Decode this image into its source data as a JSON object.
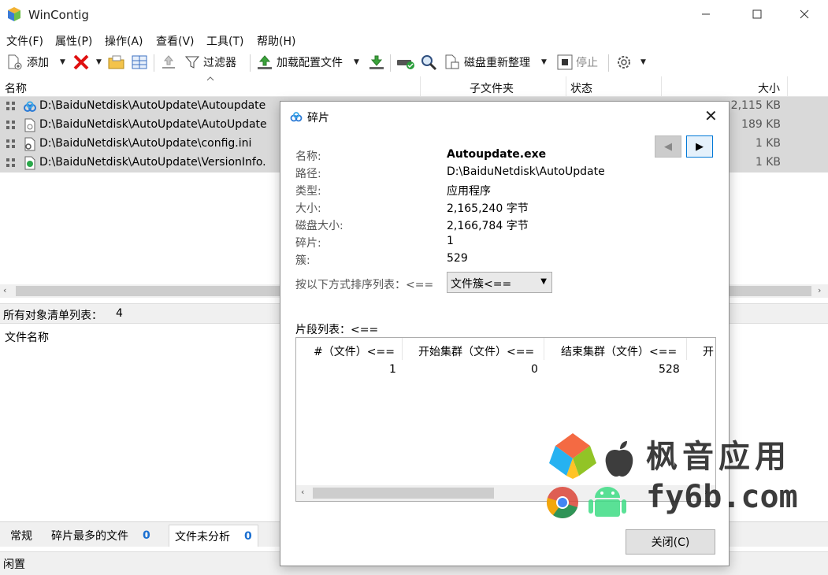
{
  "app": {
    "title": "WinContig"
  },
  "menu": [
    "文件(F)",
    "属性(P)",
    "操作(A)",
    "查看(V)",
    "工具(T)",
    "帮助(H)"
  ],
  "toolbar": {
    "add": "添加",
    "filter": "过滤器",
    "load_profile": "加载配置文件",
    "defrag": "磁盘重新整理",
    "stop": "停止"
  },
  "list": {
    "columns": {
      "name": "名称",
      "subfolder": "子文件夹",
      "status": "状态",
      "size": "大小"
    },
    "rows": [
      {
        "name": "D:\\BaiduNetdisk\\AutoUpdate\\Autoupdate",
        "size": "2,115 KB"
      },
      {
        "name": "D:\\BaiduNetdisk\\AutoUpdate\\AutoUpdate",
        "size": "189 KB"
      },
      {
        "name": "D:\\BaiduNetdisk\\AutoUpdate\\config.ini",
        "size": "1 KB"
      },
      {
        "name": "D:\\BaiduNetdisk\\AutoUpdate\\VersionInfo.",
        "size": "1 KB"
      }
    ]
  },
  "object_count": {
    "label": "所有对象清单列表：",
    "value": "4"
  },
  "file_name_label": "文件名称",
  "tabs": [
    {
      "label": "常规",
      "count": ""
    },
    {
      "label": "碎片最多的文件",
      "count": "0"
    },
    {
      "label": "文件未分析",
      "count": "0"
    }
  ],
  "status": "闲置",
  "dialog": {
    "title": "碎片",
    "fields": [
      {
        "label": "名称:",
        "value": "Autoupdate.exe"
      },
      {
        "label": "路径:",
        "value": "D:\\BaiduNetdisk\\AutoUpdate"
      },
      {
        "label": "类型:",
        "value": "应用程序"
      },
      {
        "label": "大小:",
        "value": "2,165,240 字节"
      },
      {
        "label": "磁盘大小:",
        "value": "2,166,784 字节"
      },
      {
        "label": "碎片:",
        "value": "1"
      },
      {
        "label": "簇:",
        "value": "529"
      }
    ],
    "sort_label": "按以下方式排序列表：<==",
    "sort_value": "文件簇<==",
    "fragments_label": "片段列表：<==",
    "fragment_columns": [
      "#（文件）<==",
      "开始集群（文件）<==",
      "结束集群（文件）<==",
      "开"
    ],
    "fragment_rows": [
      [
        "1",
        "0",
        "528"
      ]
    ],
    "close_button": "关闭(C)"
  },
  "watermark": {
    "line1": "枫音应用",
    "line2": "fy6b.com"
  }
}
